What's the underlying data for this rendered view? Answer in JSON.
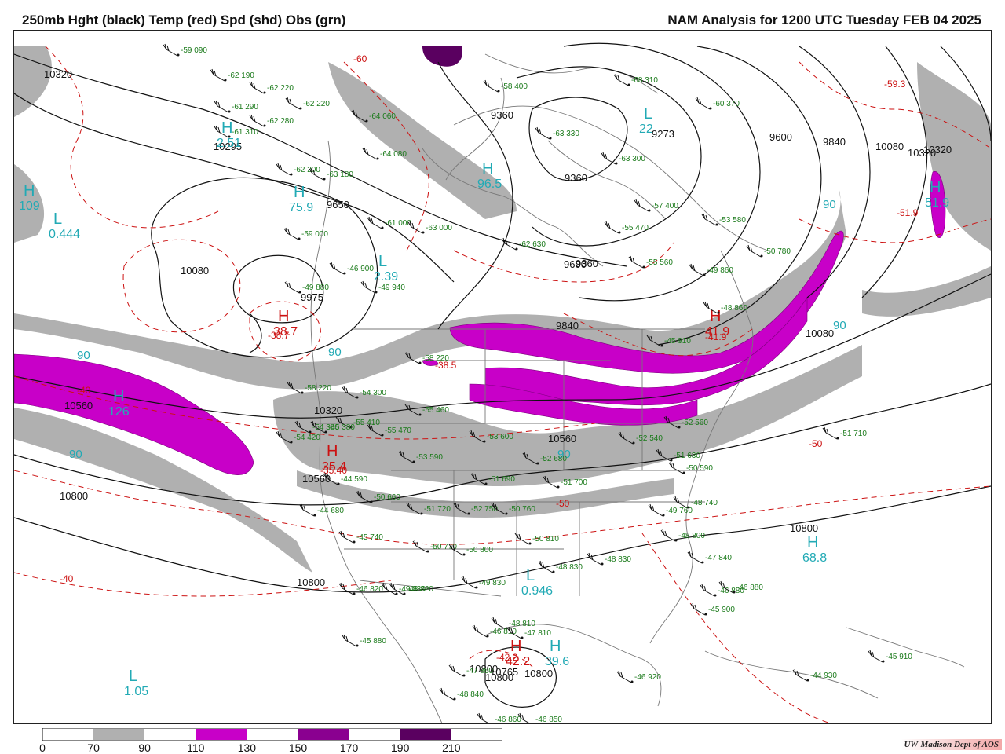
{
  "header": {
    "left_title": "250mb Hght (black) Temp (red) Spd (shd) Obs (grn)",
    "right_title": "NAM Analysis for 1200 UTC Tuesday  FEB 04 2025"
  },
  "colors": {
    "height": "#111111",
    "temp": "#cc1111",
    "obs": "#1a7a1a",
    "center_label": "#22aab5",
    "shade_70_90": "#b0b0b0",
    "shade_110_130": "#c800c8",
    "shade_150_170": "#8a0090",
    "shade_190_210": "#5a0060"
  },
  "legend": {
    "ticks": [
      "0",
      "70",
      "90",
      "110",
      "130",
      "150",
      "170",
      "190",
      "210"
    ]
  },
  "credit": "UW-Madison  Dept of AOS",
  "contour_labels": [
    {
      "text": "10320"
    },
    {
      "text": "9360"
    },
    {
      "text": "9360"
    },
    {
      "text": "9360"
    },
    {
      "text": "9600"
    },
    {
      "text": "9840"
    },
    {
      "text": "10080"
    },
    {
      "text": "10320"
    },
    {
      "text": "10080"
    },
    {
      "text": "10295"
    },
    {
      "text": "9650"
    },
    {
      "text": "9840"
    },
    {
      "text": "10080"
    },
    {
      "text": "10320"
    },
    {
      "text": "10560"
    },
    {
      "text": "10560"
    },
    {
      "text": "10560"
    },
    {
      "text": "10800"
    },
    {
      "text": "10800"
    },
    {
      "text": "10800"
    },
    {
      "text": "10800"
    },
    {
      "text": "10800"
    },
    {
      "text": "10800"
    },
    {
      "text": "10765"
    },
    {
      "text": "9600"
    },
    {
      "text": "9975"
    },
    {
      "text": "10320"
    },
    {
      "text": "9273"
    }
  ],
  "temp_labels": [
    {
      "text": "-60"
    },
    {
      "text": "-59.3"
    },
    {
      "text": "-51.9"
    },
    {
      "text": "-38.7"
    },
    {
      "text": "-38.5"
    },
    {
      "text": "-40"
    },
    {
      "text": "-40"
    },
    {
      "text": "-35.40"
    },
    {
      "text": "-50"
    },
    {
      "text": "-50"
    },
    {
      "text": "-41.9"
    },
    {
      "text": "-42.2"
    }
  ],
  "centers": [
    {
      "letter": "H",
      "value": "2.51"
    },
    {
      "letter": "L",
      "value": "0.444"
    },
    {
      "letter": "H",
      "value": "109"
    },
    {
      "letter": "H",
      "value": "96.5"
    },
    {
      "letter": "L",
      "value": "22"
    },
    {
      "letter": "H",
      "value": "75.9"
    },
    {
      "letter": "L",
      "value": "2.39"
    },
    {
      "letter": "H",
      "value": "126"
    },
    {
      "letter": "H",
      "value": "68.8"
    },
    {
      "letter": "L",
      "value": "0.946"
    },
    {
      "letter": "H",
      "value": "39.6"
    },
    {
      "letter": "L",
      "value": "1.05"
    },
    {
      "letter": "H",
      "value": "41.9"
    },
    {
      "letter": "H",
      "value": "38.7"
    },
    {
      "letter": "H",
      "value": "35.4"
    },
    {
      "letter": "H",
      "value": "42.2"
    },
    {
      "letter": "H",
      "value": "51.9"
    }
  ],
  "speed_labels": [
    {
      "text": "90"
    },
    {
      "text": "90"
    },
    {
      "text": "90"
    },
    {
      "text": "90"
    },
    {
      "text": "90"
    },
    {
      "text": "90"
    }
  ],
  "observations": [
    {
      "text": "-59 090"
    },
    {
      "text": "-62 190"
    },
    {
      "text": "-62 220"
    },
    {
      "text": "-62 220"
    },
    {
      "text": "-61 290"
    },
    {
      "text": "-62 280"
    },
    {
      "text": "-61 310"
    },
    {
      "text": "-64 060"
    },
    {
      "text": "-64 080"
    },
    {
      "text": "-62 200"
    },
    {
      "text": "-63 180"
    },
    {
      "text": "-61 000"
    },
    {
      "text": "-63 000"
    },
    {
      "text": "-59 000"
    },
    {
      "text": "-46 900"
    },
    {
      "text": "-49 880"
    },
    {
      "text": "-49 940"
    },
    {
      "text": "-58 400"
    },
    {
      "text": "-68 310"
    },
    {
      "text": "-60 370"
    },
    {
      "text": "-63 330"
    },
    {
      "text": "-63 300"
    },
    {
      "text": "-57 400"
    },
    {
      "text": "-55 470"
    },
    {
      "text": "-53 580"
    },
    {
      "text": "-62 630"
    },
    {
      "text": "-55 560"
    },
    {
      "text": "-49 860"
    },
    {
      "text": "-50 780"
    },
    {
      "text": "-45 910"
    },
    {
      "text": "-48 860"
    },
    {
      "text": "-58 220"
    },
    {
      "text": "-54 300"
    },
    {
      "text": "-55 410"
    },
    {
      "text": "-55 460"
    },
    {
      "text": "-55 470"
    },
    {
      "text": "-53 590"
    },
    {
      "text": "-50 660"
    },
    {
      "text": "-51 720"
    },
    {
      "text": "-52 750"
    },
    {
      "text": "-50 760"
    },
    {
      "text": "-50 770"
    },
    {
      "text": "-50 800"
    },
    {
      "text": "-49 830"
    },
    {
      "text": "-49 830"
    },
    {
      "text": "-50 810"
    },
    {
      "text": "-48 830"
    },
    {
      "text": "-48 830"
    },
    {
      "text": "-46 820"
    },
    {
      "text": "-48 810"
    },
    {
      "text": "-47 840"
    },
    {
      "text": "-46 880"
    },
    {
      "text": "-45 900"
    },
    {
      "text": "-45 910"
    },
    {
      "text": "-44 930"
    },
    {
      "text": "-46 920"
    },
    {
      "text": "-47 860"
    },
    {
      "text": "-48 840"
    },
    {
      "text": "-46 860"
    },
    {
      "text": "-46 850"
    },
    {
      "text": "-45 880"
    },
    {
      "text": "-46 880"
    },
    {
      "text": "-51 710"
    },
    {
      "text": "-50 590"
    },
    {
      "text": "-51 630"
    },
    {
      "text": "-48 740"
    },
    {
      "text": "-49 760"
    },
    {
      "text": "-48 800"
    },
    {
      "text": "-45 740"
    },
    {
      "text": "-48 820"
    },
    {
      "text": "-52 540"
    },
    {
      "text": "-53 600"
    },
    {
      "text": "-51 690"
    },
    {
      "text": "-52 680"
    },
    {
      "text": "-51 700"
    },
    {
      "text": "-54 420"
    },
    {
      "text": "-54 380"
    },
    {
      "text": "-58 220"
    },
    {
      "text": "-44 590"
    },
    {
      "text": "-44 680"
    },
    {
      "text": "-45 380"
    },
    {
      "text": "-52 560"
    },
    {
      "text": "-46 810"
    },
    {
      "text": "-47 810"
    }
  ]
}
